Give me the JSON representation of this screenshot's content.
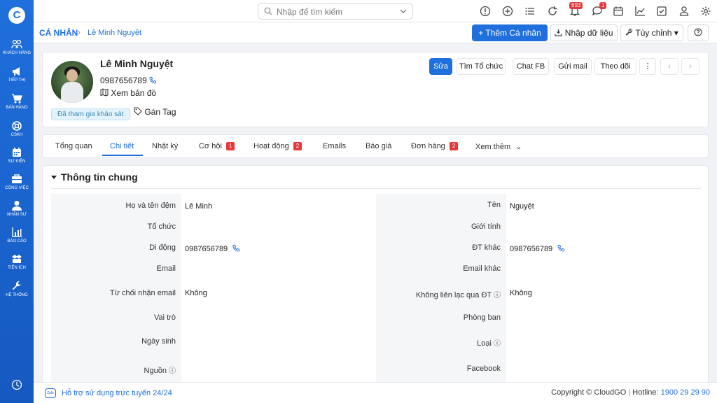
{
  "app": {
    "logo_text": "C"
  },
  "sidebar": {
    "items": [
      {
        "label": "KHÁCH HÀNG",
        "icon": "users-icon"
      },
      {
        "label": "TIẾP THỊ",
        "icon": "megaphone-icon"
      },
      {
        "label": "BÁN HÀNG",
        "icon": "cart-icon"
      },
      {
        "label": "CSKH",
        "icon": "lifebuoy-icon"
      },
      {
        "label": "SỰ KIỆN",
        "icon": "calendar-icon"
      },
      {
        "label": "CÔNG VIỆC",
        "icon": "briefcase-icon"
      },
      {
        "label": "NHÂN SỰ",
        "icon": "person-icon"
      },
      {
        "label": "BÁO CÁO",
        "icon": "bar-chart-icon"
      },
      {
        "label": "TIỆN ÍCH",
        "icon": "boxes-icon"
      },
      {
        "label": "HỆ THỐNG",
        "icon": "wrench-icon"
      }
    ]
  },
  "topbar": {
    "search_placeholder": "Nhập để tìm kiếm",
    "notification_count": "693",
    "chat_count": "1"
  },
  "subbar": {
    "module": "CÁ NHÂN",
    "record": "Lê Minh Nguyệt",
    "add_button": "Thêm Cá nhân",
    "import_button": "Nhập dữ liệu",
    "customize_button": "Tùy chỉnh"
  },
  "profile": {
    "name": "Lê Minh Nguyệt",
    "phone": "0987656789",
    "map_link": "Xem bản đồ",
    "tag": "Đã tham gia khảo sát",
    "add_tag": "Gán Tag",
    "actions": {
      "edit": "Sửa",
      "find_org": "Tìm Tổ chức",
      "chat_fb": "Chat FB",
      "send_mail": "Gửi mail",
      "follow": "Theo dõi"
    }
  },
  "tabs": [
    {
      "label": "Tổng quan",
      "count": ""
    },
    {
      "label": "Chi tiết",
      "count": ""
    },
    {
      "label": "Nhật ký",
      "count": ""
    },
    {
      "label": "Cơ hội",
      "count": "1"
    },
    {
      "label": "Hoạt động",
      "count": "2"
    },
    {
      "label": "Emails",
      "count": ""
    },
    {
      "label": "Báo giá",
      "count": ""
    },
    {
      "label": "Đơn hàng",
      "count": "2"
    },
    {
      "label": "Xem thêm",
      "count": ""
    }
  ],
  "section": {
    "title": "Thông tin chung",
    "left": [
      {
        "label": "Họ và tên đệm",
        "value": "Lê Minh"
      },
      {
        "label": "Tổ chức",
        "value": ""
      },
      {
        "label": "Di động",
        "value": "0987656789"
      },
      {
        "label": "Email",
        "value": ""
      },
      {
        "label": "Từ chối nhận email",
        "value": "Không"
      },
      {
        "label": "Vai trò",
        "value": ""
      },
      {
        "label": "Ngày sinh",
        "value": ""
      },
      {
        "label": "Nguồn",
        "value": ""
      }
    ],
    "right": [
      {
        "label": "Tên",
        "value": "Nguyệt"
      },
      {
        "label": "Giới tính",
        "value": ""
      },
      {
        "label": "ĐT khác",
        "value": "0987656789"
      },
      {
        "label": "Email khác",
        "value": ""
      },
      {
        "label": "Không liên lạc qua ĐT",
        "value": "Không"
      },
      {
        "label": "Phòng ban",
        "value": ""
      },
      {
        "label": "Loại",
        "value": ""
      },
      {
        "label": "Facebook",
        "value": ""
      }
    ]
  },
  "footer": {
    "zalo_text": "Zalo",
    "support": "Hỗ trợ sử dụng trực tuyến 24/24",
    "copyright": "Copyright © CloudGO",
    "hotline_label": "Hotline:",
    "hotline": "1900 29 29 90"
  },
  "colors": {
    "primary": "#1f6fdc",
    "badge": "#e5383b"
  }
}
